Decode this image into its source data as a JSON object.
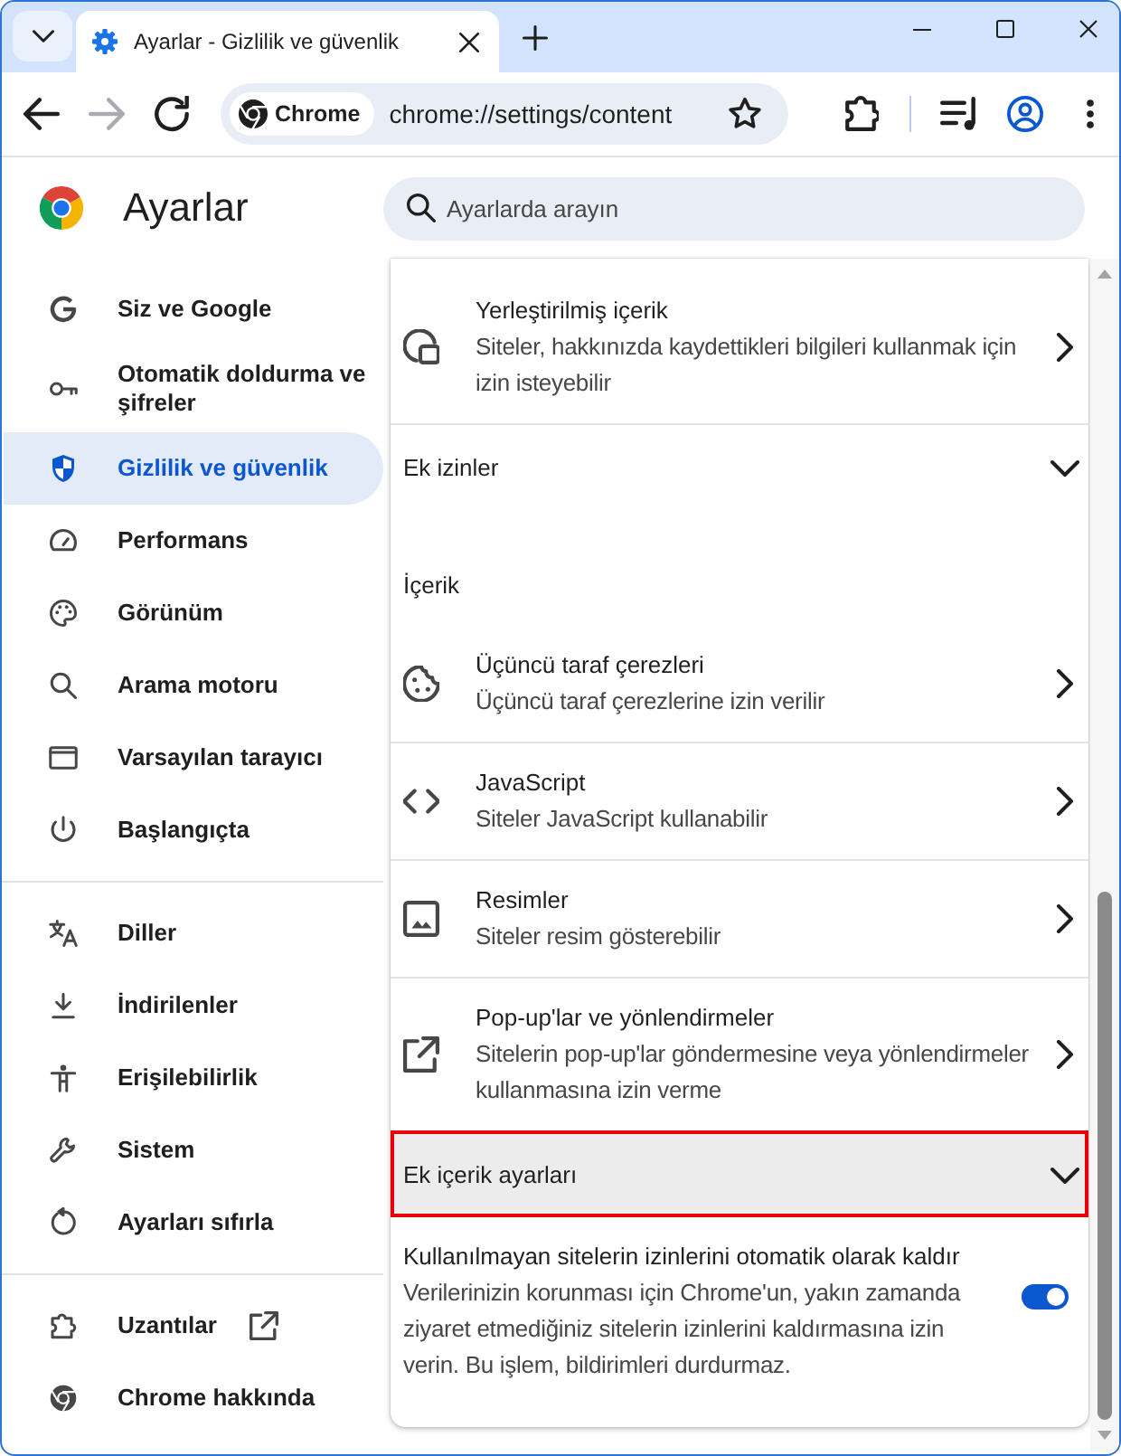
{
  "browser": {
    "tabs": [
      {
        "title": "Ayarlar - Gizlilik ve güvenlik",
        "selected": true
      }
    ],
    "nav_buttons": [
      {
        "kind": "back",
        "disabled": false
      },
      {
        "kind": "forward",
        "disabled": true
      },
      {
        "kind": "reload",
        "disabled": false
      }
    ],
    "omnibox": {
      "chip": "Chrome",
      "url": "chrome://settings/content"
    }
  },
  "header": {
    "title": "Ayarlar",
    "search": {
      "placeholder": "Ayarlarda arayın"
    }
  },
  "sidebar": {
    "groups": [
      {
        "items": [
          {
            "label": "Siz ve Google",
            "selected": false,
            "external": false
          },
          {
            "label": "Otomatik doldurma ve şifreler",
            "selected": false,
            "external": false
          },
          {
            "label": "Gizlilik ve güvenlik",
            "selected": true,
            "external": false
          },
          {
            "label": "Performans",
            "selected": false,
            "external": false
          },
          {
            "label": "Görünüm",
            "selected": false,
            "external": false
          },
          {
            "label": "Arama motoru",
            "selected": false,
            "external": false
          },
          {
            "label": "Varsayılan tarayıcı",
            "selected": false,
            "external": false
          },
          {
            "label": "Başlangıçta",
            "selected": false,
            "external": false
          }
        ]
      },
      {
        "items": [
          {
            "label": "Diller",
            "selected": false,
            "external": false
          },
          {
            "label": "İndirilenler",
            "selected": false,
            "external": false
          },
          {
            "label": "Erişilebilirlik",
            "selected": false,
            "external": false
          },
          {
            "label": "Sistem",
            "selected": false,
            "external": false
          },
          {
            "label": "Ayarları sıfırla",
            "selected": false,
            "external": false
          }
        ]
      },
      {
        "items": [
          {
            "label": "Uzantılar",
            "selected": false,
            "external": true
          },
          {
            "label": "Chrome hakkında",
            "selected": false,
            "external": false
          }
        ]
      }
    ]
  },
  "content": {
    "rows": [
      {
        "kind": "link",
        "title": "Yerleştirilmiş içerik",
        "subtitle": "Siteler, hakkınızda kaydettikleri bilgileri kullanmak için izin isteyebilir"
      },
      {
        "kind": "expander",
        "label": "Ek izinler",
        "expanded": false,
        "highlighted": false
      },
      {
        "kind": "heading",
        "label": "İçerik"
      },
      {
        "kind": "link",
        "title": "Üçüncü taraf çerezleri",
        "subtitle": "Üçüncü taraf çerezlerine izin verilir"
      },
      {
        "kind": "link",
        "title": "JavaScript",
        "subtitle": "Siteler JavaScript kullanabilir"
      },
      {
        "kind": "link",
        "title": "Resimler",
        "subtitle": "Siteler resim gösterebilir"
      },
      {
        "kind": "link",
        "title": "Pop-up'lar ve yönlendirmeler",
        "subtitle": "Sitelerin pop-up'lar göndermesine veya yönlendirmeler kullanmasına izin verme"
      },
      {
        "kind": "expander",
        "label": "Ek içerik ayarları",
        "expanded": false,
        "highlighted": true
      },
      {
        "kind": "toggle",
        "title": "Kullanılmayan sitelerin izinlerini otomatik olarak kaldır",
        "subtitle": "Verilerinizin korunması için Chrome'un, yakın zamanda ziyaret etmediğiniz sitelerin izinlerini kaldırmasına izin verin. Bu işlem, bildirimleri durdurmaz.",
        "on": true
      }
    ]
  }
}
